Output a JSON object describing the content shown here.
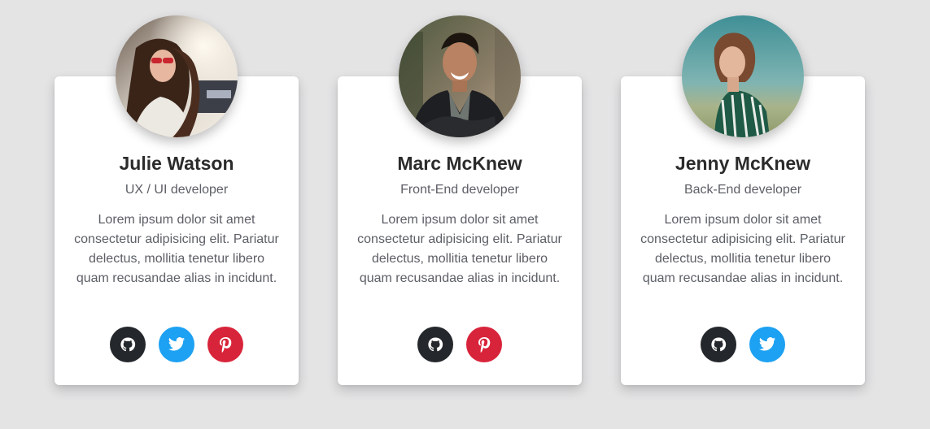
{
  "colors": {
    "page_background": "#e4e4e5",
    "card_background": "#ffffff",
    "github": "#24272b",
    "twitter": "#1da1f2",
    "pinterest": "#d8243a",
    "name_text": "#2b2b2b",
    "body_text": "#5c5f66"
  },
  "cards": [
    {
      "avatar": "photo-julie-watson",
      "name": "Julie Watson",
      "role": "UX / UI developer",
      "bio": "Lorem ipsum dolor sit amet consectetur adipisicing elit. Pariatur delectus, mollitia tenetur libero quam recusandae alias in incidunt.",
      "socials": [
        "github-icon",
        "twitter-icon",
        "pinterest-icon"
      ]
    },
    {
      "avatar": "photo-marc-mcknew",
      "name": "Marc McKnew",
      "role": "Front-End developer",
      "bio": "Lorem ipsum dolor sit amet consectetur adipisicing elit. Pariatur delectus, mollitia tenetur libero quam recusandae alias in incidunt.",
      "socials": [
        "github-icon",
        "pinterest-icon"
      ]
    },
    {
      "avatar": "photo-jenny-mcknew",
      "name": "Jenny McKnew",
      "role": "Back-End developer",
      "bio": "Lorem ipsum dolor sit amet consectetur adipisicing elit. Pariatur delectus, mollitia tenetur libero quam recusandae alias in incidunt.",
      "socials": [
        "github-icon",
        "twitter-icon"
      ]
    }
  ]
}
